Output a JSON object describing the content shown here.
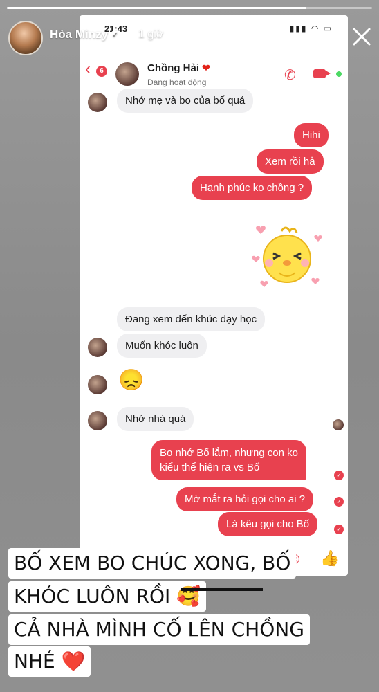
{
  "story": {
    "username": "Hòa Minzy",
    "time": "1 giờ",
    "progress_fraction": 0.82
  },
  "phone": {
    "status_time": "21:43",
    "status_icons": "▮▮▮ ◠ ▭"
  },
  "chat": {
    "back_count": "6",
    "contact_name": "Chồng Hải",
    "contact_status": "Đang hoạt động",
    "dots": "· · ·",
    "messages": [
      {
        "text": "Nhớ mẹ và bo của bố quá"
      },
      {
        "text": "Hihi"
      },
      {
        "text": "Xem rồi hả"
      },
      {
        "text": "Hạnh phúc ko chồng ?"
      },
      {
        "text": "Đang xem đến khúc dạy học"
      },
      {
        "text": "Muốn khóc luôn"
      },
      {
        "text": "😞"
      },
      {
        "text": "Nhớ nhà quá"
      },
      {
        "text": "Bo nhớ Bố lắm, nhưng con ko"
      },
      {
        "text": "kiểu thể hiện ra vs Bố"
      },
      {
        "text": "Mờ mắt ra hỏi gọi cho ai ?"
      },
      {
        "text": "Là kêu gọi cho Bố"
      }
    ]
  },
  "caption": {
    "line1": "BỐ XEM BO CHÚC XONG, BỐ",
    "line2": "KHÓC LUÔN RỒI 🥰",
    "line3": "CẢ NHÀ MÌNH CỐ LÊN CHỒNG",
    "line4": "NHÉ ❤️"
  },
  "colors": {
    "accent": "#e8414f",
    "incoming_bubble": "#efeff1"
  }
}
